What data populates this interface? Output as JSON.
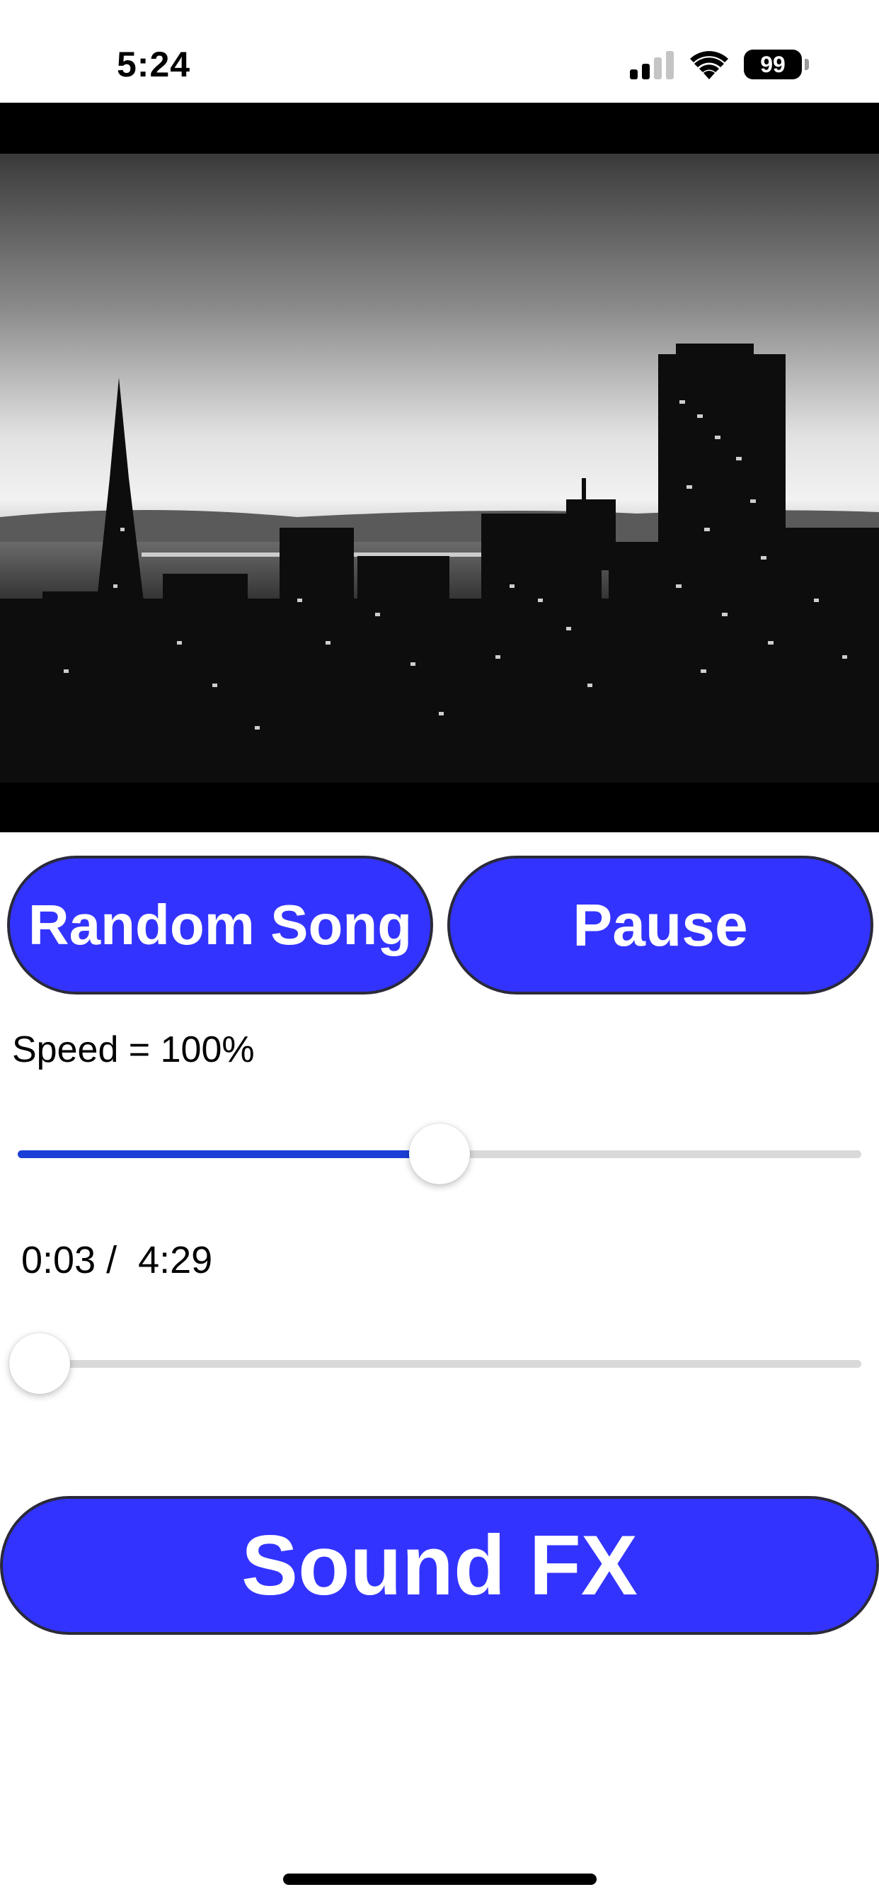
{
  "status_bar": {
    "time": "5:24",
    "battery": "99",
    "signal_icon": "cellular-signal-icon",
    "wifi_icon": "wifi-icon"
  },
  "video": {
    "description_icon": "city-skyline-video"
  },
  "controls": {
    "random_song_label": "Random Song",
    "pause_label": "Pause",
    "accent_color": "#3333ff"
  },
  "speed": {
    "label": "Speed = 100%",
    "value_fraction": 0.5
  },
  "playback": {
    "time_label": "0:03 /  4:29",
    "value_fraction": 0.0116
  },
  "sound_fx": {
    "label": "Sound FX"
  }
}
